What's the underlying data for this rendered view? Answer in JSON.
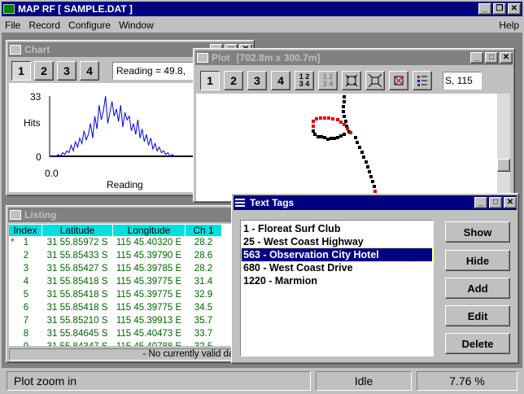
{
  "app": {
    "title": "MAP RF [ SAMPLE.DAT ]"
  },
  "menu": {
    "file": "File",
    "record": "Record",
    "configure": "Configure",
    "window": "Window",
    "help": "Help"
  },
  "chart": {
    "title": "Chart",
    "buttons": [
      "1",
      "2",
      "3",
      "4"
    ],
    "reading_box": "Reading = 49.8,",
    "ymax": "33",
    "ylabel": "Hits",
    "ymin": "0",
    "xmin": "0.0",
    "xlabel": "Reading"
  },
  "chart_data": {
    "type": "line",
    "title": "",
    "xlabel": "Reading",
    "ylabel": "Hits",
    "ylim": [
      0,
      33
    ],
    "x_start": "0.0",
    "series": [
      {
        "name": "",
        "values": [
          0,
          0,
          0,
          0,
          1,
          0,
          2,
          1,
          3,
          2,
          6,
          3,
          8,
          5,
          10,
          7,
          14,
          9,
          12,
          18,
          10,
          22,
          15,
          28,
          20,
          25,
          33,
          18,
          24,
          30,
          22,
          26,
          19,
          28,
          16,
          24,
          20,
          22,
          14,
          18,
          12,
          20,
          10,
          15,
          8,
          12,
          6,
          10,
          4,
          7,
          3,
          5,
          2,
          3,
          1,
          2,
          0,
          1,
          0,
          0
        ]
      }
    ]
  },
  "plot": {
    "title": "Plot",
    "dims": "[702.8m x 300.7m]",
    "buttons": [
      "1",
      "2",
      "3",
      "4"
    ],
    "coord_box": "S, 115"
  },
  "listing": {
    "title": "Listing",
    "columns": [
      "Index",
      "Latitude",
      "Longitude",
      "Ch 1"
    ],
    "rows": [
      {
        "marker": "*",
        "index": "1",
        "lat": "31 55.85972 S",
        "lon": "115 45.40320 E",
        "ch1": "28.2"
      },
      {
        "marker": "",
        "index": "2",
        "lat": "31 55.85433 S",
        "lon": "115 45.39790 E",
        "ch1": "28.6"
      },
      {
        "marker": "",
        "index": "3",
        "lat": "31 55.85427 S",
        "lon": "115 45.39785 E",
        "ch1": "28.2"
      },
      {
        "marker": "",
        "index": "4",
        "lat": "31 55.85418 S",
        "lon": "115 45.39775 E",
        "ch1": "31.4"
      },
      {
        "marker": "",
        "index": "5",
        "lat": "31 55.85418 S",
        "lon": "115 45.39775 E",
        "ch1": "32.9"
      },
      {
        "marker": "",
        "index": "6",
        "lat": "31 55.85418 S",
        "lon": "115 45.39775 E",
        "ch1": "34.5"
      },
      {
        "marker": "",
        "index": "7",
        "lat": "31 55.85210 S",
        "lon": "115 45.39913 E",
        "ch1": "35.7"
      },
      {
        "marker": "",
        "index": "8",
        "lat": "31 55.84645 S",
        "lon": "115 45.40473 E",
        "ch1": "33.7"
      },
      {
        "marker": "",
        "index": "9",
        "lat": "31 55.84347 S",
        "lon": "115 45.40788 E",
        "ch1": "32.5"
      }
    ],
    "footer": "- No currently valid data -"
  },
  "tags": {
    "title": "Text Tags",
    "items": [
      "1 - Floreat Surf Club",
      "25 - West Coast Highway",
      "563 - Observation City Hotel",
      "680 - West Coast Drive",
      "1220 - Marmion"
    ],
    "selected_index": 2,
    "show": "Show",
    "hide": "Hide",
    "add": "Add",
    "edit": "Edit",
    "delete": "Delete"
  },
  "status": {
    "message": "Plot zoom in",
    "state": "Idle",
    "percent": "7.76 %"
  },
  "colors": {
    "titlebar": "#000080",
    "data_text": "#006400",
    "header_bg": "#00e0e0",
    "track_red": "#e00000"
  }
}
